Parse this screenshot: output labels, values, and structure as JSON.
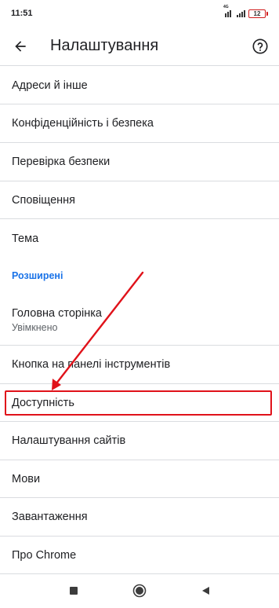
{
  "status_bar": {
    "time": "11:51",
    "signal_tag": "4G",
    "battery": "12"
  },
  "header": {
    "title": "Налаштування"
  },
  "items": [
    {
      "label": "Адреси й інше"
    },
    {
      "label": "Конфіденційність і безпека"
    },
    {
      "label": "Перевірка безпеки"
    },
    {
      "label": "Сповіщення"
    },
    {
      "label": "Тема"
    },
    {
      "label": "Головна сторінка",
      "sub": "Увімкнено"
    },
    {
      "label": "Кнопка на панелі інструментів"
    },
    {
      "label": "Доступність"
    },
    {
      "label": "Налаштування сайтів"
    },
    {
      "label": "Мови"
    },
    {
      "label": "Завантаження"
    },
    {
      "label": "Про Chrome"
    }
  ],
  "section": {
    "advanced": "Розширені"
  },
  "colors": {
    "accent": "#1a73e8",
    "annotation": "#e0121a"
  },
  "icons": {
    "back": "arrow-left-icon",
    "help": "help-circle-icon",
    "nav_recents": "square-icon",
    "nav_home": "circle-icon",
    "nav_back": "triangle-icon"
  }
}
